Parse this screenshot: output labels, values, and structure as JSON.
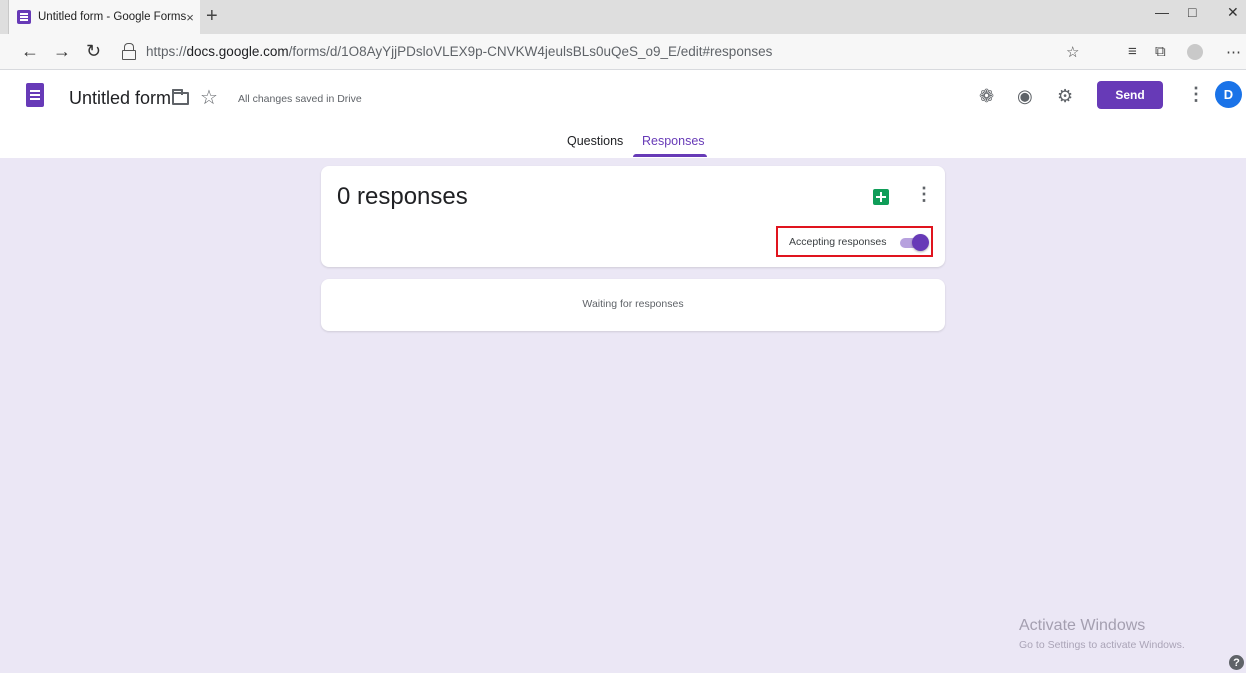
{
  "browser": {
    "tab_title": "Untitled form - Google Forms",
    "tab_close": "×",
    "new_tab": "+",
    "url_prefix": "https://",
    "url_host": "docs.google.com",
    "url_path": "/forms/d/1O8AyYjjPDsloVLEX9p-CNVKW4jeulsBLs0uQeS_o9_E/edit#responses",
    "icons": [
      "back-arrow-icon",
      "forward-arrow-icon",
      "refresh-icon",
      "lock-icon",
      "star-icon",
      "favorites-icon",
      "collections-icon",
      "profile-icon",
      "more-icon"
    ]
  },
  "header": {
    "form_title": "Untitled form",
    "saved_status": "All changes saved in Drive",
    "send_label": "Send",
    "avatar_letter": "D",
    "tabs": [
      {
        "label": "Questions",
        "active": false
      },
      {
        "label": "Responses",
        "active": true
      }
    ]
  },
  "responses": {
    "count_label": "0 responses",
    "accepting_label": "Accepting responses",
    "accepting": true,
    "waiting_label": "Waiting for responses"
  },
  "watermark": {
    "title": "Activate Windows",
    "subtitle": "Go to Settings to activate Windows."
  },
  "colors": {
    "accent": "#673ab7",
    "background": "#ebe7f5",
    "highlight_box": "#e0141e",
    "sheets_green": "#0f9d58"
  }
}
